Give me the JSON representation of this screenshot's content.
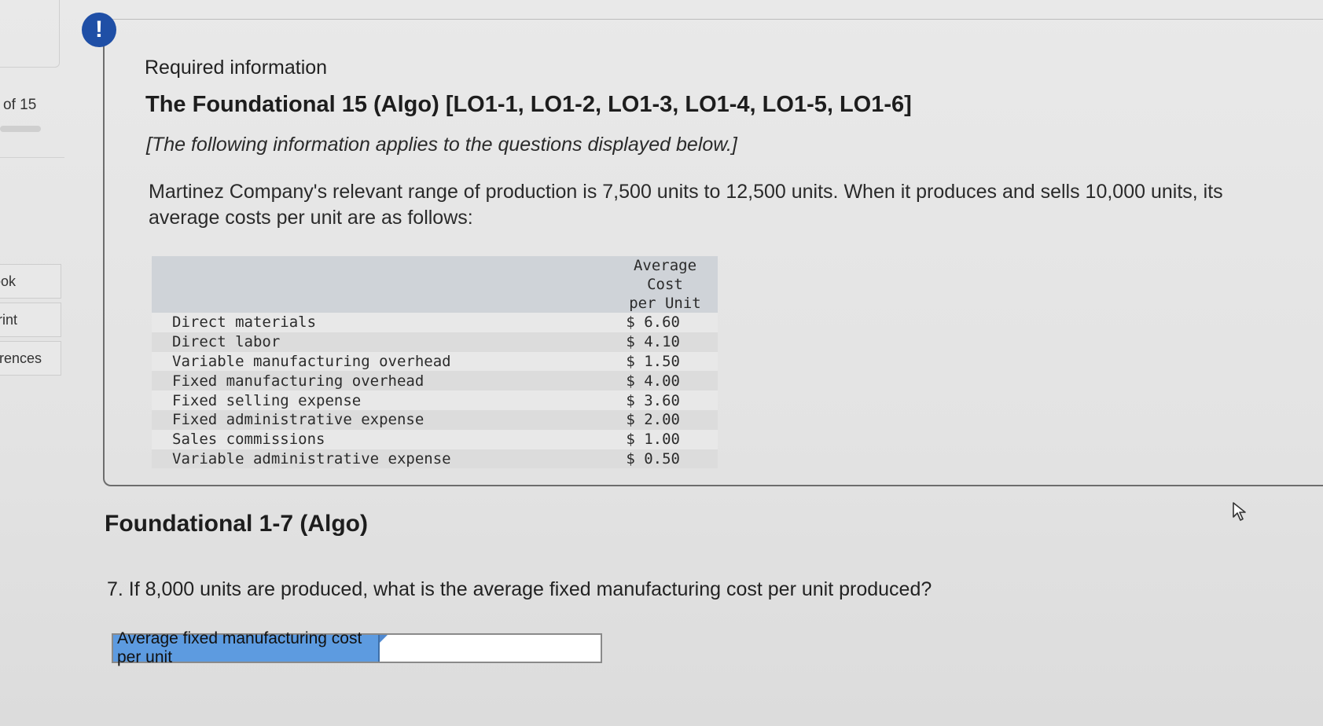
{
  "sidebar": {
    "counter": "of 15",
    "links": [
      {
        "label": "Book"
      },
      {
        "label": "Print"
      },
      {
        "label": "rences"
      }
    ]
  },
  "alert": {
    "symbol": "!"
  },
  "info": {
    "heading": "Required information",
    "title": "The Foundational 15 (Algo) [LO1-1, LO1-2, LO1-3, LO1-4, LO1-5, LO1-6]",
    "note": "[The following information applies to the questions displayed below.]",
    "intro": "Martinez Company's relevant range of production is 7,500 units to 12,500 units. When it produces and sells 10,000 units, its average costs per unit are as follows:"
  },
  "cost_table": {
    "header_line1": "Average Cost",
    "header_line2": "per Unit",
    "rows": [
      {
        "label": "Direct materials",
        "value": "$ 6.60"
      },
      {
        "label": "Direct labor",
        "value": "$ 4.10"
      },
      {
        "label": "Variable manufacturing overhead",
        "value": "$ 1.50"
      },
      {
        "label": "Fixed manufacturing overhead",
        "value": "$ 4.00"
      },
      {
        "label": "Fixed selling expense",
        "value": "$ 3.60"
      },
      {
        "label": "Fixed administrative expense",
        "value": "$ 2.00"
      },
      {
        "label": "Sales commissions",
        "value": "$ 1.00"
      },
      {
        "label": "Variable administrative expense",
        "value": "$ 0.50"
      }
    ]
  },
  "question": {
    "section_title": "Foundational 1-7 (Algo)",
    "text": "7. If 8,000 units are produced, what is the average fixed manufacturing cost per unit produced?",
    "answer_label": "Average fixed manufacturing cost per unit",
    "answer_value": ""
  },
  "colors": {
    "alert_badge": "#1f4fa6",
    "answer_label_bg": "#5d9be0",
    "table_header_bg": "#cfd3d8"
  }
}
